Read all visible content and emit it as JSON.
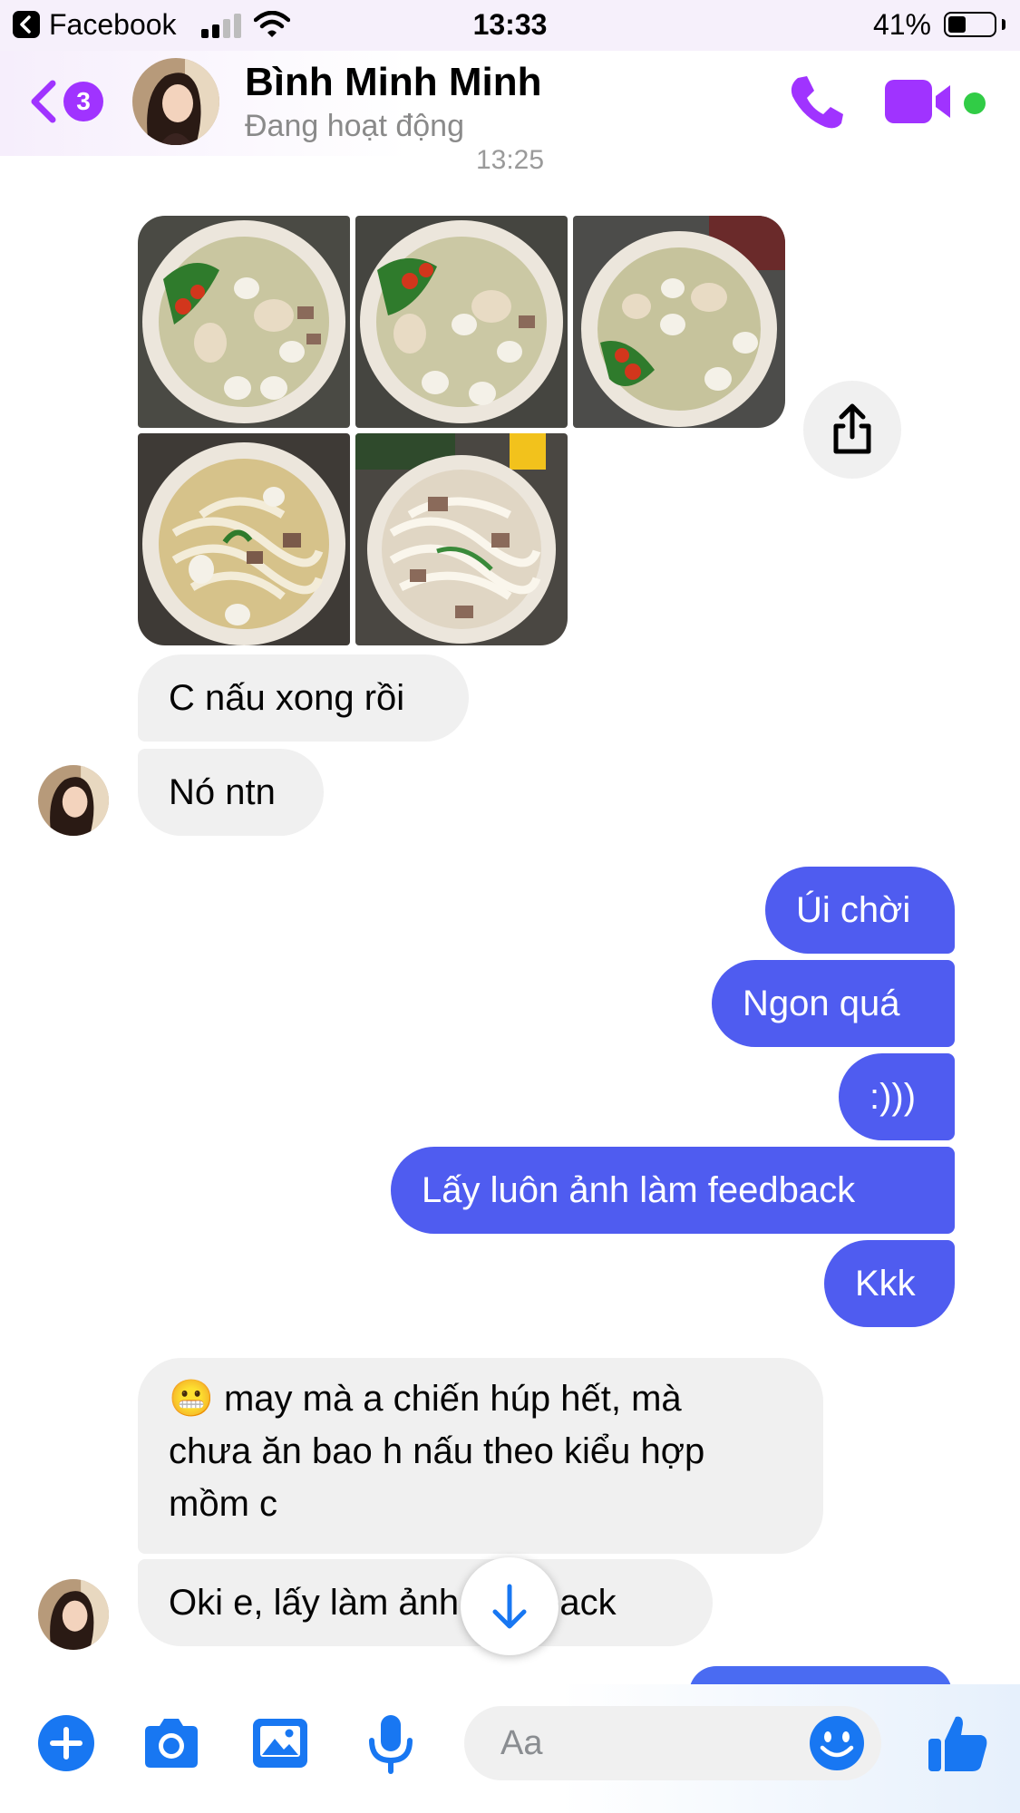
{
  "status_bar": {
    "back_app": "Facebook",
    "time": "13:33",
    "battery_percent": "41%",
    "battery_level": 0.41
  },
  "header": {
    "back_badge_count": "3",
    "contact_name": "Bình Minh Minh",
    "contact_status": "Đang hoạt động"
  },
  "conversation": {
    "timestamp": "13:25",
    "photo_count": 5,
    "incoming_1": [
      "C nấu xong rồi",
      "Nó ntn"
    ],
    "outgoing": [
      "Úi chời",
      "Ngon quá",
      ":)))",
      "Lấy luôn ảnh làm feedback",
      "Kkk"
    ],
    "incoming_2": {
      "emoji": "😬",
      "line_1": "may mà a chiến húp hết, mà",
      "line_2": "chưa ăn bao h nấu theo kiểu hợp",
      "line_3": "mồm c",
      "last": "Oki e, lấy làm ảnh feedback"
    }
  },
  "composer": {
    "placeholder": "Aa"
  },
  "colors": {
    "accent_purple": "#a033ff",
    "outgoing_bubble": "#4f5cf0",
    "incoming_bubble": "#f0f0f0",
    "icon_blue": "#1877f2",
    "active_green": "#31cc46"
  },
  "icons": [
    "back-chevron-icon",
    "phone-icon",
    "video-camera-icon",
    "share-icon",
    "arrow-down-icon",
    "plus-icon",
    "camera-icon",
    "gallery-icon",
    "microphone-icon",
    "emoji-icon",
    "thumbs-up-icon"
  ]
}
